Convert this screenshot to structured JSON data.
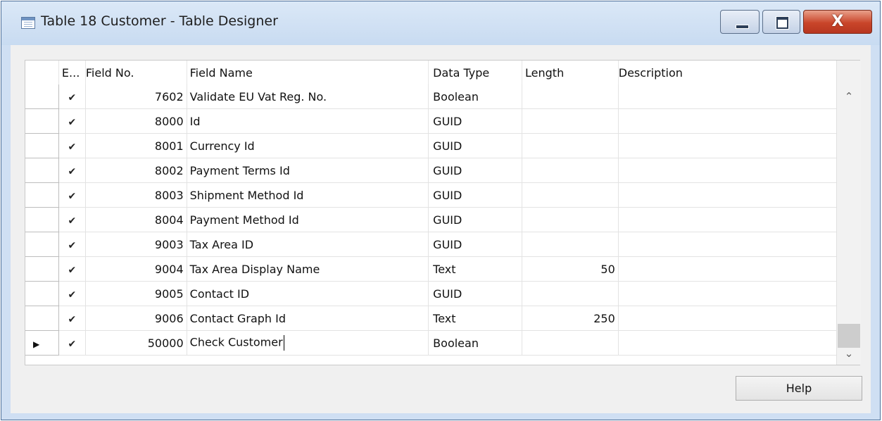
{
  "window": {
    "title": "Table 18 Customer - Table Designer",
    "close_symbol": "X"
  },
  "columns": {
    "enabled": "E...",
    "field_no": "Field No.",
    "field_name": "Field Name",
    "data_type": "Data Type",
    "length": "Length",
    "description": "Description"
  },
  "rows": [
    {
      "enabled": "✔",
      "no": "7602",
      "name": "Validate EU Vat Reg. No.",
      "type": "Boolean",
      "length": "",
      "description": ""
    },
    {
      "enabled": "✔",
      "no": "8000",
      "name": "Id",
      "type": "GUID",
      "length": "",
      "description": ""
    },
    {
      "enabled": "✔",
      "no": "8001",
      "name": "Currency Id",
      "type": "GUID",
      "length": "",
      "description": ""
    },
    {
      "enabled": "✔",
      "no": "8002",
      "name": "Payment Terms Id",
      "type": "GUID",
      "length": "",
      "description": ""
    },
    {
      "enabled": "✔",
      "no": "8003",
      "name": "Shipment Method Id",
      "type": "GUID",
      "length": "",
      "description": ""
    },
    {
      "enabled": "✔",
      "no": "8004",
      "name": "Payment Method Id",
      "type": "GUID",
      "length": "",
      "description": ""
    },
    {
      "enabled": "✔",
      "no": "9003",
      "name": "Tax Area ID",
      "type": "GUID",
      "length": "",
      "description": ""
    },
    {
      "enabled": "✔",
      "no": "9004",
      "name": "Tax Area Display Name",
      "type": "Text",
      "length": "50",
      "description": ""
    },
    {
      "enabled": "✔",
      "no": "9005",
      "name": "Contact ID",
      "type": "GUID",
      "length": "",
      "description": ""
    },
    {
      "enabled": "✔",
      "no": "9006",
      "name": "Contact Graph Id",
      "type": "Text",
      "length": "250",
      "description": ""
    },
    {
      "enabled": "✔",
      "no": "50000",
      "name": "Check Customer",
      "type": "Boolean",
      "length": "",
      "description": "",
      "current": true
    }
  ],
  "current_row_marker": "▶",
  "scrollbar": {
    "up_icon": "chevron-up-icon",
    "down_icon": "chevron-down-icon"
  },
  "buttons": {
    "help": "Help"
  }
}
